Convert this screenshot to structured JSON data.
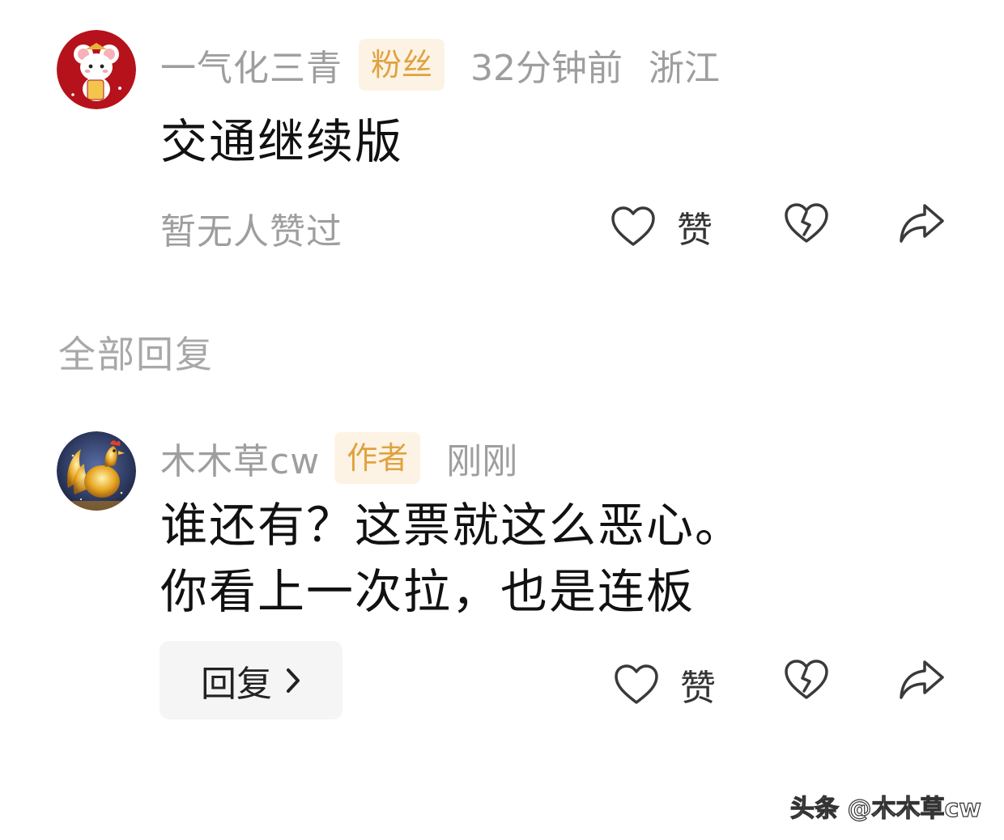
{
  "comment": {
    "avatar_icon": "mouse-avatar-icon",
    "username": "一气化三青",
    "badge": "粉丝",
    "time": "32分钟前",
    "location": "浙江",
    "content": "交通继续版",
    "likes_text": "暂无人赞过",
    "like_label": "赞"
  },
  "section": {
    "title": "全部回复"
  },
  "reply": {
    "avatar_icon": "rooster-avatar-icon",
    "username": "木木草cw",
    "badge": "作者",
    "time": "刚刚",
    "content_line1": "谁还有？这票就这么恶心。",
    "content_line2": "你看上一次拉，也是连板",
    "reply_button_label": "回复",
    "like_label": "赞"
  },
  "watermark": "头条 @木木草cw",
  "colors": {
    "badge_bg": "#fdf3e4",
    "badge_text": "#e0a240",
    "meta_text": "#9e9e9e",
    "content_text": "#111111"
  }
}
